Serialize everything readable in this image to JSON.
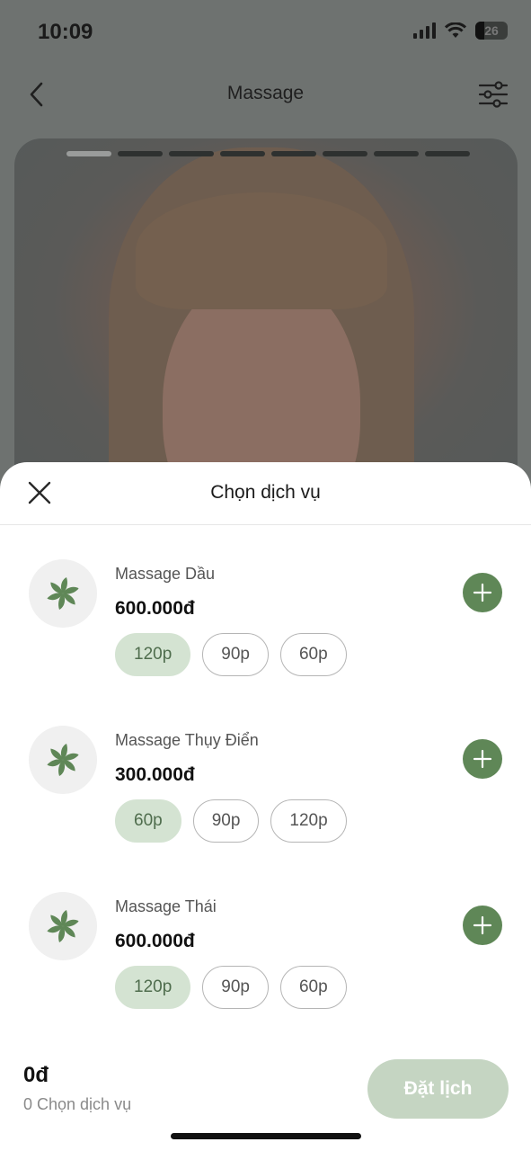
{
  "status": {
    "time": "10:09",
    "battery": "26"
  },
  "nav": {
    "title": "Massage"
  },
  "gallery": {
    "total_slides": 8,
    "active_index": 0
  },
  "sheet": {
    "title": "Chọn dịch vụ"
  },
  "services": [
    {
      "name": "Massage Dầu",
      "price": "600.000đ",
      "durations": [
        "120p",
        "90p",
        "60p"
      ],
      "selected": 0
    },
    {
      "name": "Massage Thụy Điển",
      "price": "300.000đ",
      "durations": [
        "60p",
        "90p",
        "120p"
      ],
      "selected": 0
    },
    {
      "name": "Massage Thái",
      "price": "600.000đ",
      "durations": [
        "120p",
        "90p",
        "60p"
      ],
      "selected": 0
    }
  ],
  "footer": {
    "total": "0đ",
    "count_label": "0 Chọn dịch vụ",
    "book_label": "Đặt lịch"
  },
  "colors": {
    "accent": "#5f8757",
    "selected_chip": "#d4e3d2",
    "book_disabled": "#c5d5c2"
  }
}
